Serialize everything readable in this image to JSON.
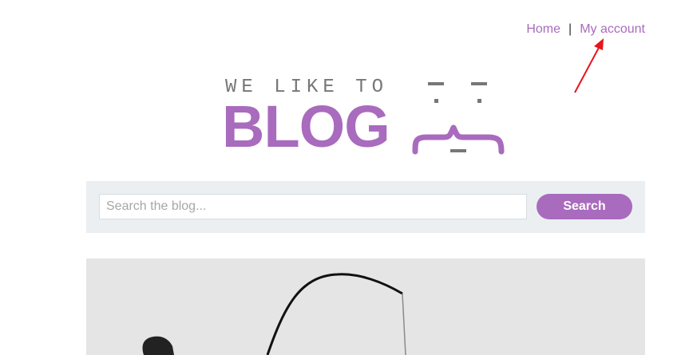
{
  "nav": {
    "home_label": "Home",
    "separator": "|",
    "account_label": "My account"
  },
  "logo": {
    "top_text": "WE LIKE TO",
    "main_text": "BLOG"
  },
  "search": {
    "placeholder": "Search the blog...",
    "value": "",
    "button_label": "Search"
  },
  "colors": {
    "accent": "#a96bbd",
    "search_band": "#ebeff2",
    "hero_background": "#e5e5e5",
    "annotation_arrow": "#e8141c"
  },
  "icons": {
    "logo_face": "face-emoticon-icon",
    "annotation": "red-arrow-icon"
  }
}
